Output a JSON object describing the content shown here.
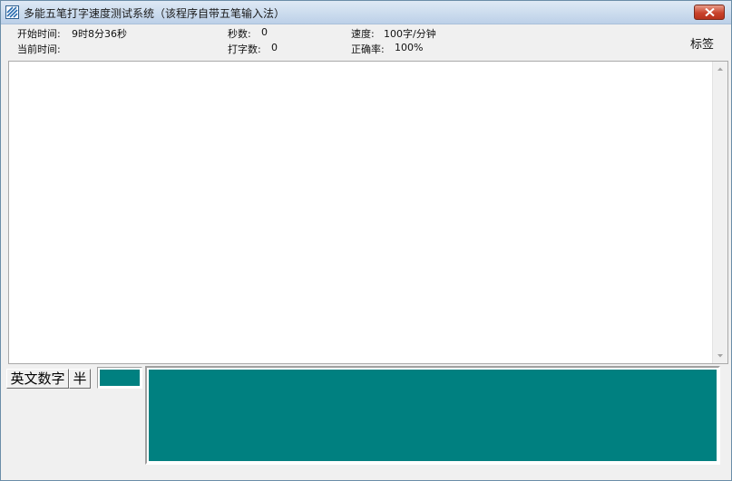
{
  "window": {
    "title": "多能五笔打字速度测试系统（该程序自带五笔输入法）"
  },
  "stats": {
    "start_time_label": "开始时间:",
    "start_time_value": "9时8分36秒",
    "current_time_label": "当前时间:",
    "current_time_value": "",
    "seconds_label": "秒数:",
    "seconds_value": "0",
    "typed_count_label": "打字数:",
    "typed_count_value": "0",
    "speed_label": "速度:",
    "speed_value": "100字/分钟",
    "accuracy_label": "正确率:",
    "accuracy_value": "100%",
    "tag_label": "标签"
  },
  "input_mode": {
    "mode_label": "英文数字",
    "width_label": "半"
  },
  "colors": {
    "panel_teal": "#008080",
    "close_red": "#c9432c"
  },
  "icons": {
    "app": "wubi-app-icon",
    "close": "close-icon",
    "scroll_up": "triangle-up-icon",
    "scroll_down": "triangle-down-icon"
  }
}
